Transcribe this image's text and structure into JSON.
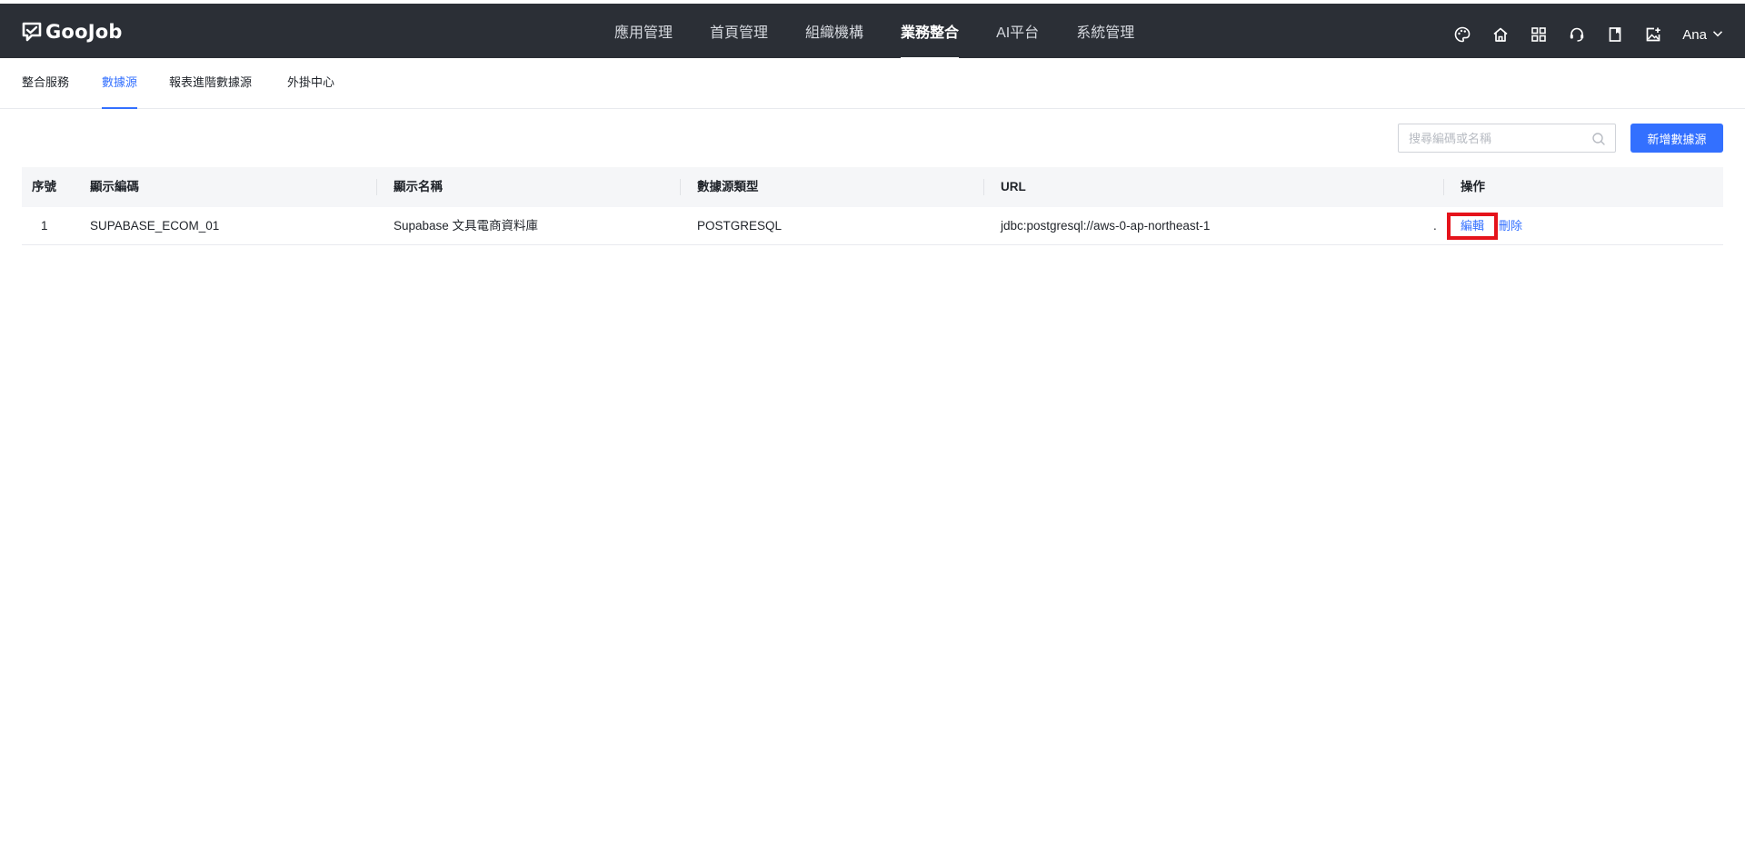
{
  "app": {
    "logo_text": "GooJob"
  },
  "main_nav": {
    "items": [
      {
        "label": "應用管理"
      },
      {
        "label": "首頁管理"
      },
      {
        "label": "組織機構"
      },
      {
        "label": "業務整合",
        "active": true
      },
      {
        "label": "AI平台"
      },
      {
        "label": "系統管理"
      }
    ]
  },
  "header_tools": {
    "icons": [
      "palette-icon",
      "home-icon",
      "apps-grid-icon",
      "support-icon",
      "book-icon",
      "image-upload-icon"
    ],
    "user_name": "Ana"
  },
  "sub_nav": {
    "tabs": [
      {
        "label": "整合服務"
      },
      {
        "label": "數據源",
        "active": true
      },
      {
        "label": "報表進階數據源"
      },
      {
        "label": "外掛中心"
      }
    ]
  },
  "toolbar": {
    "search_placeholder": "搜尋編碼或名稱",
    "search_value": "",
    "add_button_label": "新增數據源"
  },
  "table": {
    "columns": [
      "序號",
      "顯示編碼",
      "顯示名稱",
      "數據源類型",
      "URL",
      "操作"
    ],
    "rows": [
      {
        "index": "1",
        "code": "SUPABASE_ECOM_01",
        "name": "Supabase 文具電商資料庫",
        "type": "POSTGRESQL",
        "url": "jdbc:postgresql://aws-0-ap-northeast-1",
        "url_tail": ".",
        "actions": {
          "edit": "編輯",
          "delete": "刪除"
        }
      }
    ]
  },
  "colors": {
    "header_bg": "#2b2f36",
    "accent": "#3370ff",
    "highlight_box": "#e5131b",
    "table_header_bg": "#f5f6f8"
  }
}
